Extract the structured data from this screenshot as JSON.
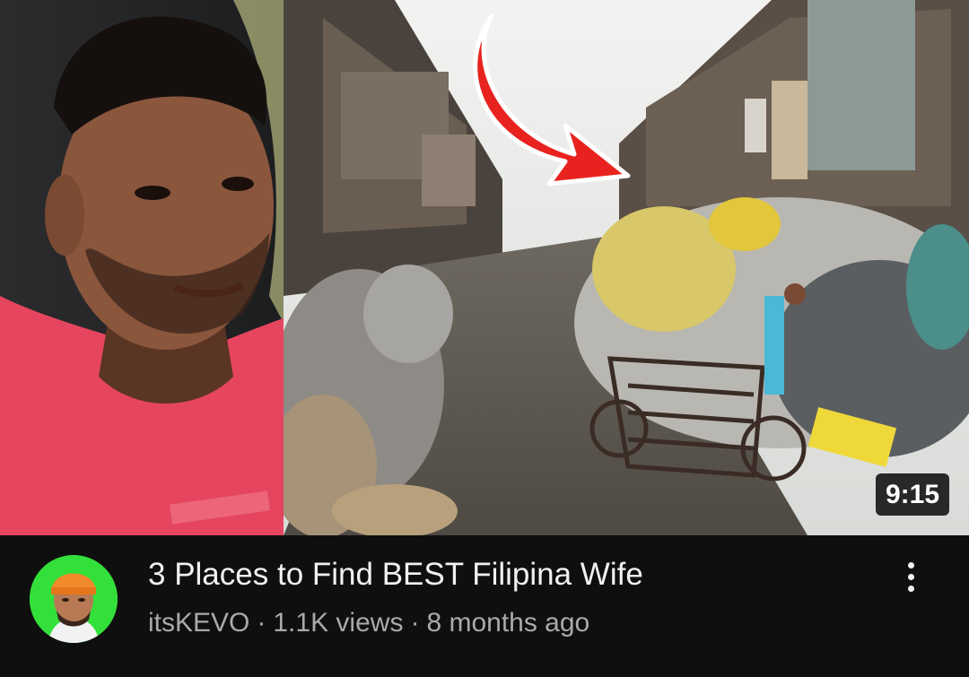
{
  "video": {
    "title": "3 Places to Find BEST Filipina Wife",
    "duration": "9:15",
    "channel": "itsKEVO",
    "views": "1.1K views",
    "age": "8 months ago",
    "separator": "·"
  },
  "thumbnail": {
    "description_icons": [
      "person-face",
      "red-arrow",
      "garbage-street"
    ],
    "accent_arrow_color": "#e8231f"
  },
  "avatar": {
    "icon": "channel-avatar-icon",
    "background_color": "#33e03a"
  },
  "menu": {
    "icon": "more-vert-icon"
  }
}
